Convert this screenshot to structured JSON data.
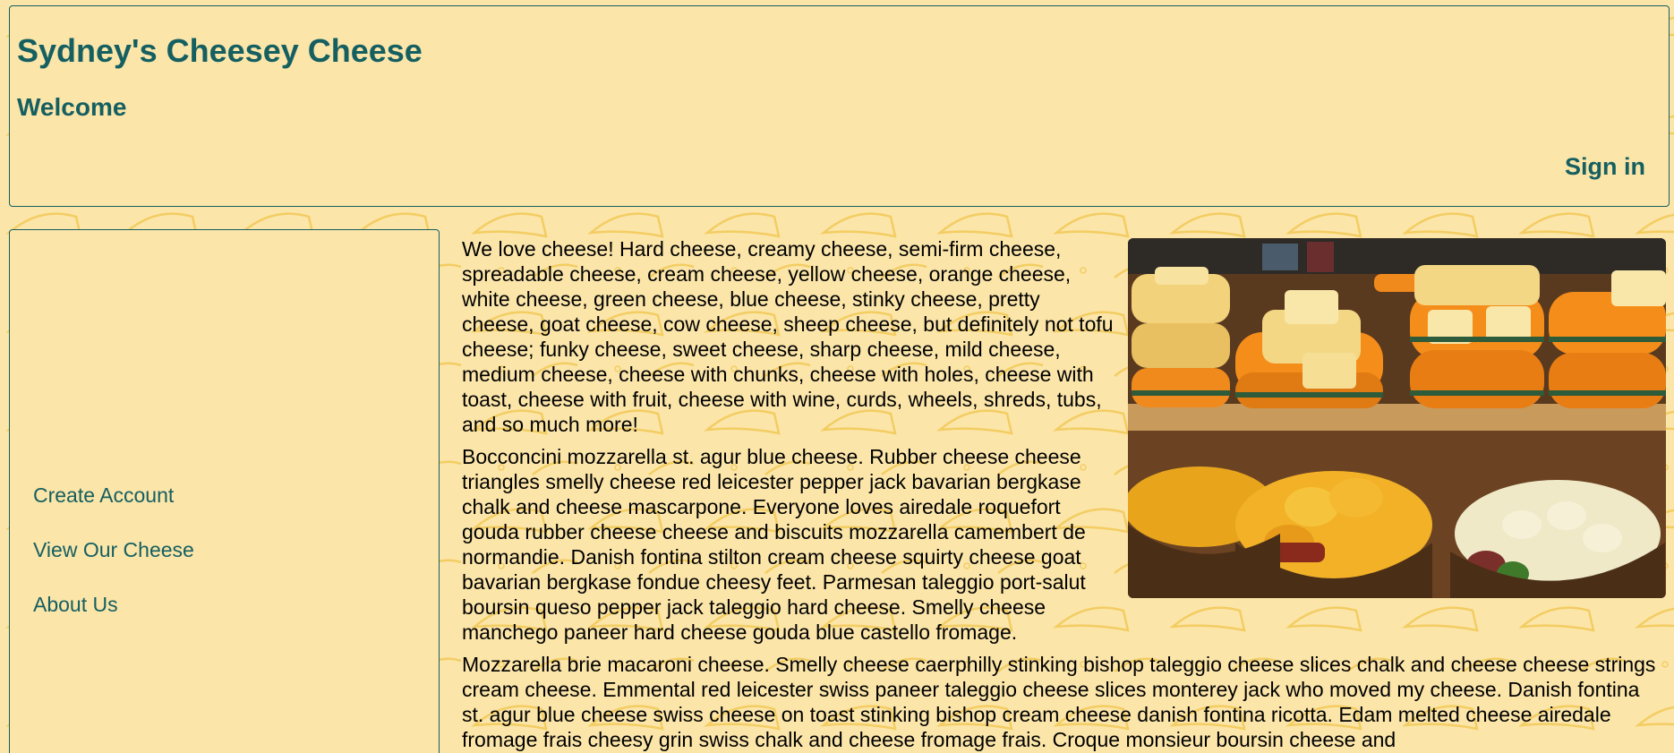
{
  "header": {
    "site_title": "Sydney's Cheesey Cheese",
    "welcome": "Welcome",
    "sign_in_label": "Sign in"
  },
  "sidebar": {
    "items": [
      {
        "label": "Create Account"
      },
      {
        "label": "View Our Cheese"
      },
      {
        "label": "About Us"
      }
    ]
  },
  "main": {
    "image": {
      "icon": "cheese-shop-photo"
    },
    "paragraphs": [
      "We love cheese! Hard cheese, creamy cheese, semi-firm cheese, spreadable cheese, cream cheese, yellow cheese, orange cheese, white cheese, green cheese, blue cheese, stinky cheese, pretty cheese, goat cheese, cow cheese, sheep cheese, but definitely not tofu cheese; funky cheese, sweet cheese, sharp cheese, mild cheese, medium cheese, cheese with chunks, cheese with holes, cheese with toast, cheese with fruit, cheese with wine, curds, wheels, shreds, tubs, and so much more!",
      "Bocconcini mozzarella st. agur blue cheese. Rubber cheese cheese triangles smelly cheese red leicester pepper jack bavarian bergkase chalk and cheese mascarpone. Everyone loves airedale roquefort gouda rubber cheese cheese and biscuits mozzarella camembert de normandie. Danish fontina stilton cream cheese squirty cheese goat bavarian bergkase fondue cheesy feet. Parmesan taleggio port-salut boursin queso pepper jack taleggio hard cheese. Smelly cheese manchego paneer hard cheese gouda blue castello fromage.",
      "Mozzarella brie macaroni cheese. Smelly cheese caerphilly stinking bishop taleggio cheese slices chalk and cheese cheese strings cream cheese. Emmental red leicester swiss paneer taleggio cheese slices monterey jack who moved my cheese. Danish fontina st. agur blue cheese swiss cheese on toast stinking bishop cream cheese danish fontina ricotta. Edam melted cheese airedale fromage frais cheesy grin swiss chalk and cheese fromage frais. Croque monsieur boursin cheese and"
    ]
  },
  "colors": {
    "background": "#fbe5a9",
    "accent": "#155f61",
    "pattern": "#f2c94c"
  }
}
